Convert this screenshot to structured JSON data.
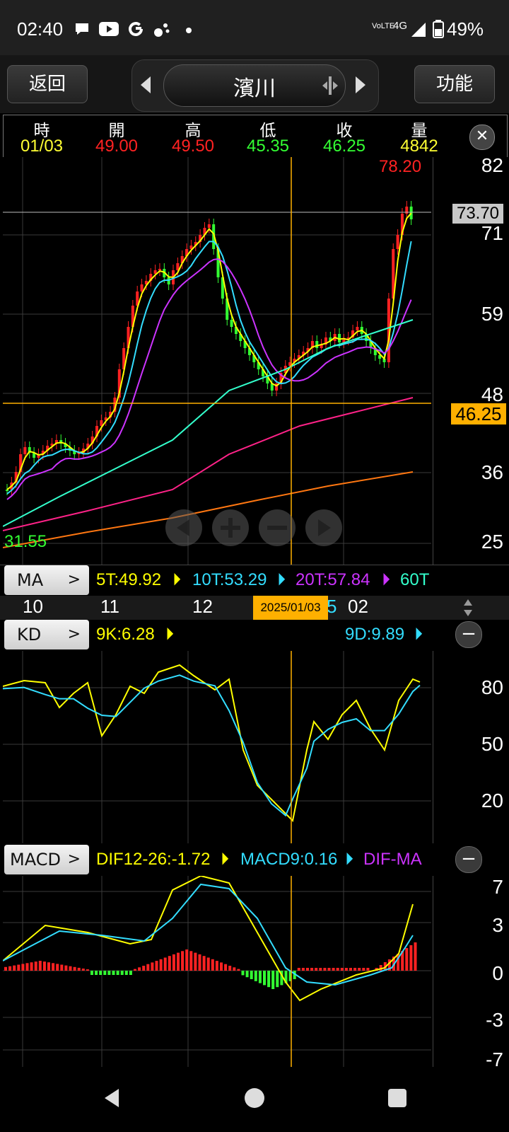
{
  "status_bar": {
    "time": "02:40",
    "icons": [
      "chat-icon",
      "youtube-icon",
      "google-icon",
      "settings-dots-icon",
      "dot-icon"
    ],
    "network_label": "VoLTE",
    "network_type": "4G",
    "battery": "49%"
  },
  "header": {
    "back_label": "返回",
    "title": "濱川",
    "function_label": "功能"
  },
  "quote": {
    "headers": [
      "時",
      "開",
      "高",
      "低",
      "收",
      "量"
    ],
    "values": [
      "01/03",
      "49.00",
      "49.50",
      "45.35",
      "46.25",
      "4842"
    ],
    "colors": [
      "#ffff33",
      "#ff2222",
      "#ff2222",
      "#33ff33",
      "#33ff33",
      "#ffff33"
    ]
  },
  "price_panel": {
    "y_labels": [
      "82",
      "71",
      "59",
      "48",
      "36",
      "25"
    ],
    "high_marker": "78.20",
    "low_marker": "31.55",
    "last_price_tag": "73.70",
    "crosshair_price_tag": "46.25"
  },
  "ma_bar": {
    "label": "MA",
    "items": [
      {
        "text": "5T:49.92",
        "color": "#ffff00"
      },
      {
        "text": "10T:53.29",
        "color": "#33ddff"
      },
      {
        "text": "20T:57.84",
        "color": "#cc33ff"
      },
      {
        "text": "60T",
        "color": "#33ffcc"
      }
    ]
  },
  "time_axis": {
    "labels": [
      "10",
      "11",
      "12",
      "02"
    ],
    "selected_date": "2025/01/03",
    "partial_label": "5"
  },
  "kd_bar": {
    "label": "KD",
    "k": "9K:6.28",
    "d": "9D:9.89",
    "y_labels": [
      "80",
      "50",
      "20"
    ]
  },
  "macd_bar": {
    "label": "MACD",
    "dif": "DIF12-26:-1.72",
    "macd": "MACD9:0.16",
    "diff": "DIF-MA",
    "y_labels": [
      "7",
      "3",
      "0",
      "-3",
      "-7"
    ]
  },
  "colors": {
    "up": "#ff2222",
    "down": "#33ff33",
    "ma5": "#ffff00",
    "ma10": "#33ddff",
    "ma20": "#cc33ff",
    "ma60": "#33ffcc",
    "ma120": "#ff2288",
    "ma240": "#ff7711",
    "crosshair": "#ffb000"
  }
}
